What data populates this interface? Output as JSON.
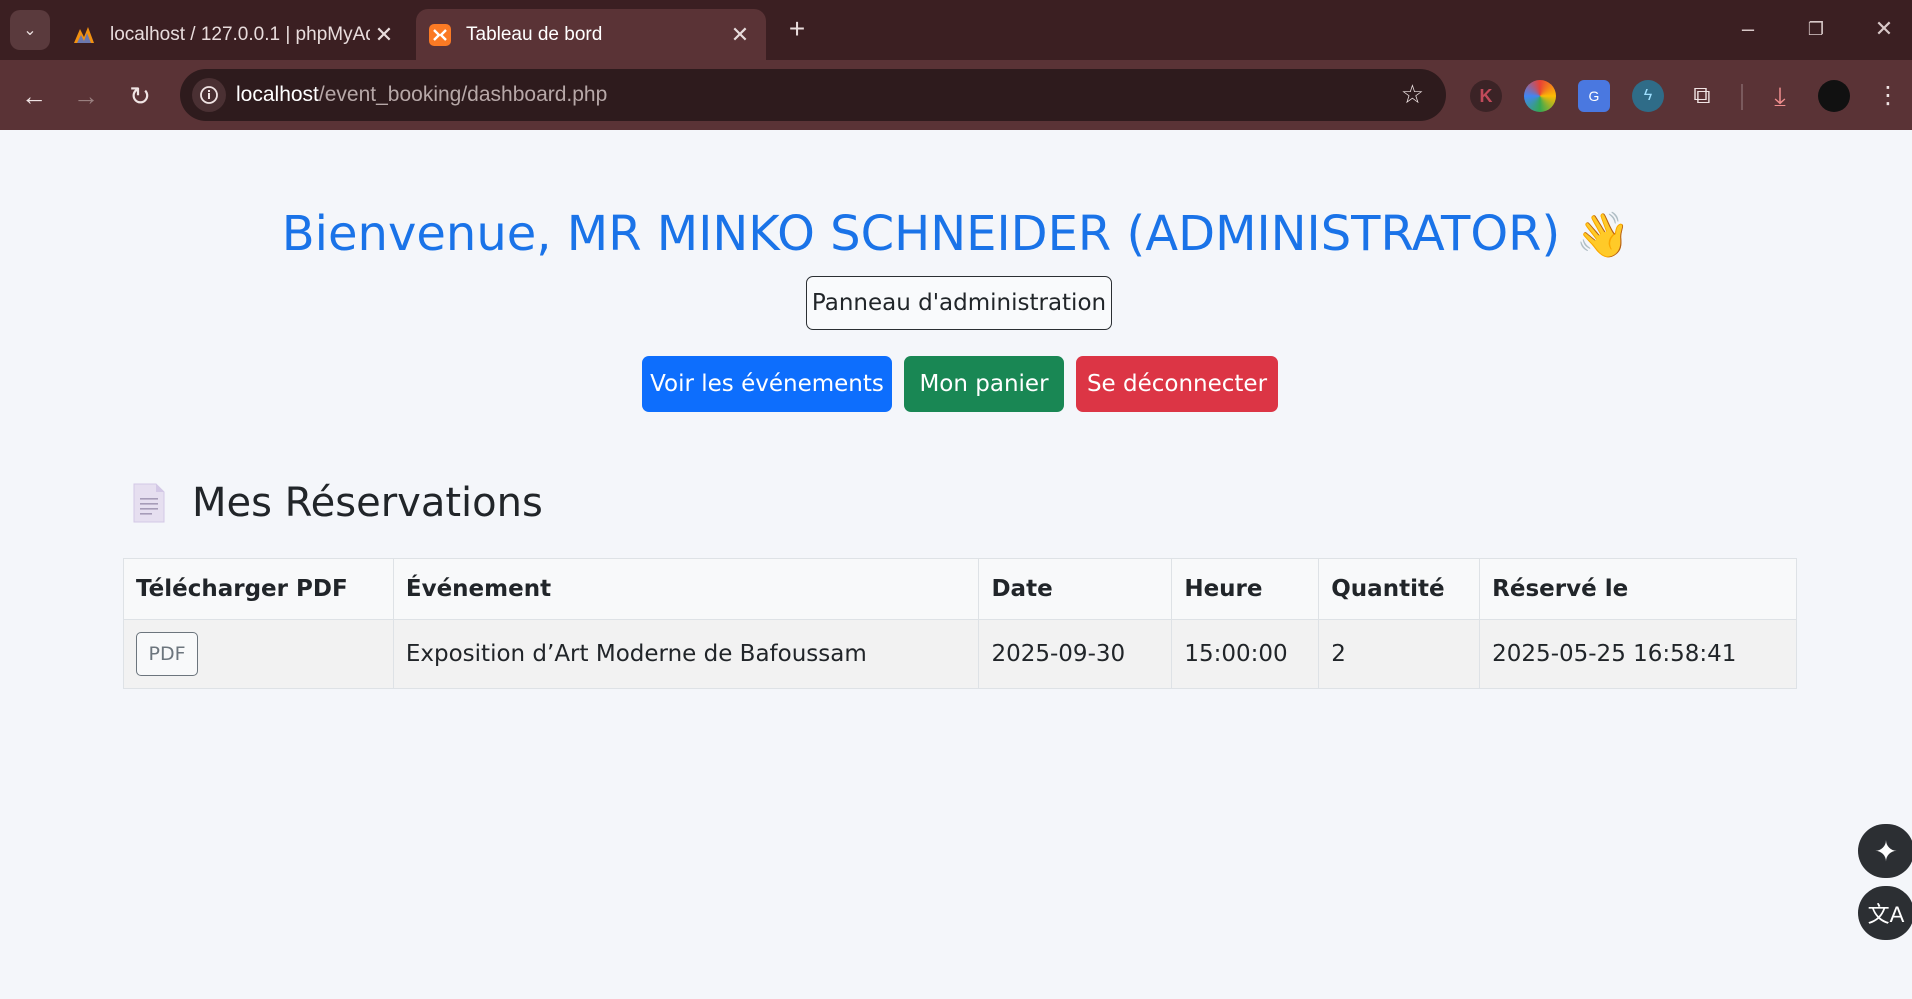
{
  "browser": {
    "tabs": [
      {
        "title": "localhost / 127.0.0.1 | phpMyAdmin",
        "active": false,
        "favicon": "phpmyadmin-icon"
      },
      {
        "title": "Tableau de bord",
        "active": true,
        "favicon": "xampp-icon"
      }
    ],
    "url_host": "localhost",
    "url_path": "/event_booking/dashboard.php"
  },
  "header": {
    "welcome": "Bienvenue, MR MINKO SCHNEIDER (ADMINISTRATOR)",
    "wave": "👋",
    "admin_panel": "Panneau d'administration"
  },
  "actions": {
    "events": "Voir les événements",
    "cart": "Mon panier",
    "logout": "Se déconnecter"
  },
  "colors": {
    "primary": "#0d6efd",
    "success": "#198754",
    "danger": "#dc3545",
    "heading": "#1a73e8"
  },
  "reservations": {
    "title": "Mes Réservations",
    "columns": [
      "Télécharger PDF",
      "Événement",
      "Date",
      "Heure",
      "Quantité",
      "Réservé le"
    ],
    "rows": [
      {
        "pdf_label": "PDF",
        "event": "Exposition d’Art Moderne de Bafoussam",
        "date": "2025-09-30",
        "time": "15:00:00",
        "quantity": "2",
        "reserved_at": "2025-05-25 16:58:41"
      }
    ]
  }
}
